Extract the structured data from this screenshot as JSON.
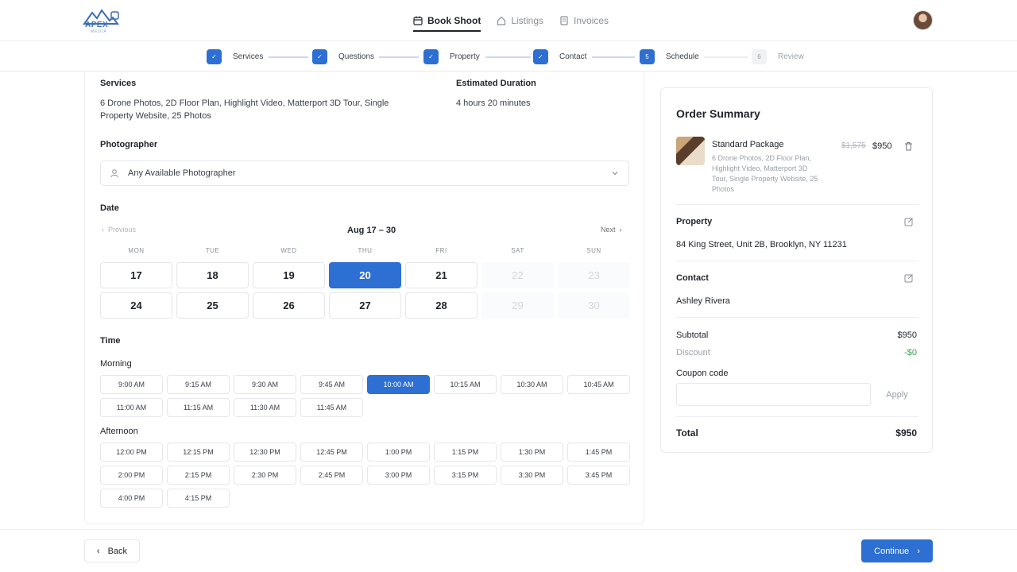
{
  "brand": {
    "name": "APEX",
    "sub": "MEDIA",
    "accent": "#2d6fd2"
  },
  "nav": [
    {
      "label": "Book Shoot",
      "icon": "calendar-icon",
      "active": true
    },
    {
      "label": "Listings",
      "icon": "home-icon",
      "active": false
    },
    {
      "label": "Invoices",
      "icon": "receipt-icon",
      "active": false
    }
  ],
  "steps": [
    {
      "label": "Services",
      "marker": "✓",
      "state": "done"
    },
    {
      "label": "Questions",
      "marker": "✓",
      "state": "done"
    },
    {
      "label": "Property",
      "marker": "✓",
      "state": "done"
    },
    {
      "label": "Contact",
      "marker": "✓",
      "state": "done"
    },
    {
      "label": "Schedule",
      "marker": "5",
      "state": "current"
    },
    {
      "label": "Review",
      "marker": "6",
      "state": "pending"
    }
  ],
  "services": {
    "heading": "Services",
    "text_line1": "6 Drone Photos, 2D Floor Plan, Highlight Video, Matterport 3D Tour, Single",
    "text_line2": "Property Website, 25 Photos",
    "duration_heading": "Estimated Duration",
    "duration": "4 hours 20 minutes"
  },
  "photographer": {
    "heading": "Photographer",
    "value": "Any Available Photographer"
  },
  "date": {
    "heading": "Date",
    "prev": "Previous",
    "next": "Next",
    "range": "Aug 17 – 30",
    "weekdays": [
      "MON",
      "TUE",
      "WED",
      "THU",
      "FRI",
      "SAT",
      "SUN"
    ],
    "weeks": [
      [
        {
          "d": "17",
          "s": "on"
        },
        {
          "d": "18",
          "s": "on"
        },
        {
          "d": "19",
          "s": "on"
        },
        {
          "d": "20",
          "s": "sel"
        },
        {
          "d": "21",
          "s": "on"
        },
        {
          "d": "22",
          "s": "off"
        },
        {
          "d": "23",
          "s": "off"
        }
      ],
      [
        {
          "d": "24",
          "s": "on"
        },
        {
          "d": "25",
          "s": "on"
        },
        {
          "d": "26",
          "s": "on"
        },
        {
          "d": "27",
          "s": "on"
        },
        {
          "d": "28",
          "s": "on"
        },
        {
          "d": "29",
          "s": "off"
        },
        {
          "d": "30",
          "s": "off"
        }
      ]
    ]
  },
  "time": {
    "heading": "Time",
    "morning_label": "Morning",
    "morning": [
      "9:00 AM",
      "9:15 AM",
      "9:30 AM",
      "9:45 AM",
      "10:00 AM",
      "10:15 AM",
      "10:30 AM",
      "10:45 AM",
      "11:00 AM",
      "11:15 AM",
      "11:30 AM",
      "11:45 AM"
    ],
    "selected": "10:00 AM",
    "afternoon_label": "Afternoon",
    "afternoon": [
      "12:00 PM",
      "12:15 PM",
      "12:30 PM",
      "12:45 PM",
      "1:00 PM",
      "1:15 PM",
      "1:30 PM",
      "1:45 PM",
      "2:00 PM",
      "2:15 PM",
      "2:30 PM",
      "2:45 PM",
      "3:00 PM",
      "3:15 PM",
      "3:30 PM",
      "3:45 PM",
      "4:00 PM",
      "4:15 PM"
    ]
  },
  "summary": {
    "title": "Order Summary",
    "package_name": "Standard Package",
    "package_desc": [
      "6 Drone Photos, 2D Floor Plan,",
      "Highlight Video, Matterport 3D",
      "Tour, Single Property Website, 25",
      "Photos"
    ],
    "old_price": "$1,575",
    "price": "$950",
    "property_heading": "Property",
    "property": "84 King Street, Unit 2B, Brooklyn, NY 11231",
    "contact_heading": "Contact",
    "contact": "Ashley Rivera",
    "subtotal_label": "Subtotal",
    "subtotal": "$950",
    "discount_label": "Discount",
    "discount": "-$0",
    "coupon_label": "Coupon code",
    "coupon_value": "",
    "apply": "Apply",
    "total_label": "Total",
    "total": "$950"
  },
  "footer": {
    "back": "Back",
    "continue": "Continue"
  }
}
